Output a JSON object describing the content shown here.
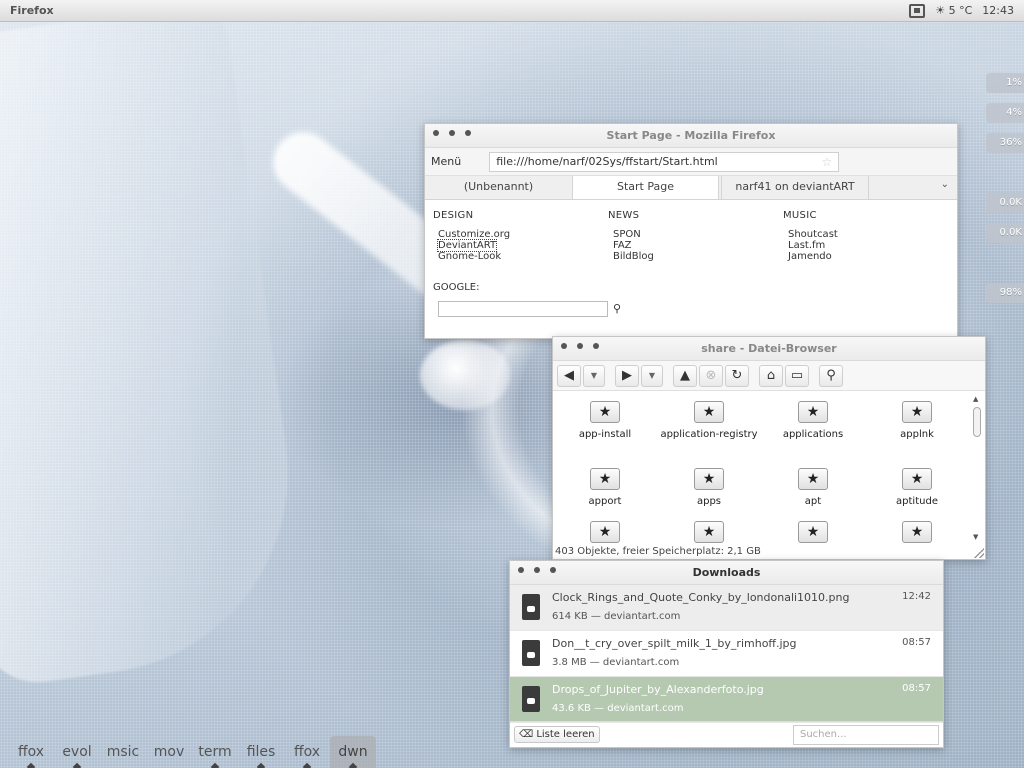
{
  "top_panel": {
    "app_name": "Firefox",
    "weather": "5 °C",
    "clock": "12:43"
  },
  "meters": [
    "1%",
    "4%",
    "36%",
    "0.0K",
    "0.0K",
    "98%"
  ],
  "firefox": {
    "title": "Start Page - Mozilla Firefox",
    "menu_label": "Menü",
    "url": "file:///home/narf/02Sys/ffstart/Start.html",
    "tabs": [
      "(Unbenannt)",
      "Start Page",
      "narf41 on deviantART"
    ],
    "columns": [
      {
        "heading": "DESIGN",
        "links": [
          "Customize.org",
          "DeviantART",
          "Gnome-Look"
        ]
      },
      {
        "heading": "NEWS",
        "links": [
          "SPON",
          "FAZ",
          "BildBlog"
        ]
      },
      {
        "heading": "MUSIC",
        "links": [
          "Shoutcast",
          "Last.fm",
          "Jamendo"
        ]
      }
    ],
    "google_label": "GOOGLE:"
  },
  "file_browser": {
    "title": "share - Datei-Browser",
    "items": [
      "app-install",
      "application-registry",
      "applications",
      "applnk",
      "apport",
      "apps",
      "apt",
      "aptitude",
      "",
      "",
      "",
      ""
    ],
    "status": "403 Objekte, freier Speicherplatz: 2,1 GB"
  },
  "downloads": {
    "title": "Downloads",
    "items": [
      {
        "name": "Clock_Rings_and_Quote_Conky_by_londonali1010.png",
        "meta": "614 KB — deviantart.com",
        "time": "12:42"
      },
      {
        "name": "Don__t_cry_over_spilt_milk_1_by_rimhoff.jpg",
        "meta": "3.8 MB — deviantart.com",
        "time": "08:57"
      },
      {
        "name": "Drops_of_Jupiter_by_Alexanderfoto.jpg",
        "meta": "43.6 KB — deviantart.com",
        "time": "08:57"
      }
    ],
    "clear_label": "Liste leeren",
    "search_placeholder": "Suchen..."
  },
  "dock": {
    "items": [
      "ffox",
      "evol",
      "msic",
      "mov",
      "term",
      "files",
      "ffox",
      "dwn"
    ],
    "active": "dwn"
  },
  "colors": {
    "selected_row": "#b5c9b1",
    "panel": "#e6e6e6"
  }
}
